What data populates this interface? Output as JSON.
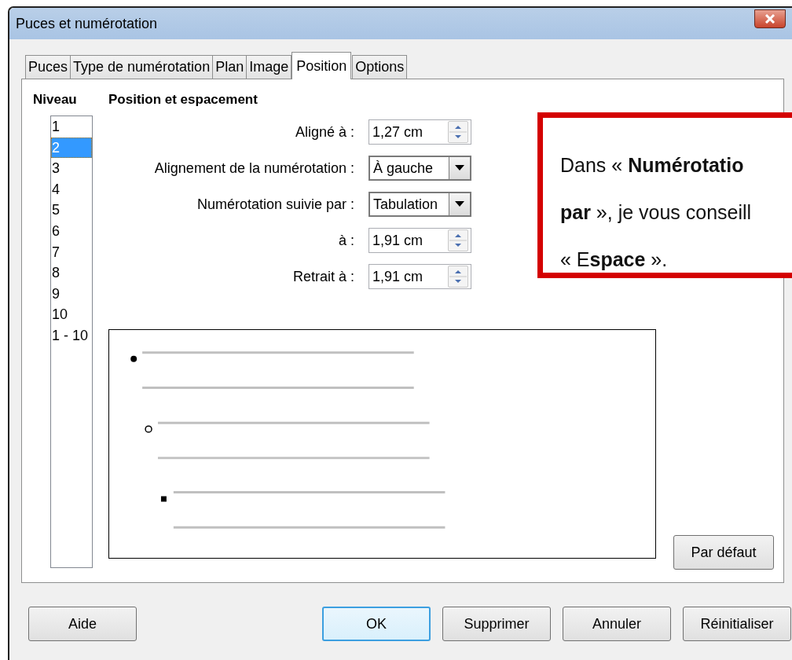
{
  "window": {
    "title": "Puces et numérotation"
  },
  "tabs": [
    {
      "label": "Puces",
      "selected": false
    },
    {
      "label": "Type de numérotation",
      "selected": false
    },
    {
      "label": "Plan",
      "selected": false
    },
    {
      "label": "Image",
      "selected": false
    },
    {
      "label": "Position",
      "selected": true
    },
    {
      "label": "Options",
      "selected": false
    }
  ],
  "level_list": {
    "label": "Niveau",
    "items": [
      {
        "label": "1",
        "selected": false
      },
      {
        "label": "2",
        "selected": true
      },
      {
        "label": "3",
        "selected": false
      },
      {
        "label": "4",
        "selected": false
      },
      {
        "label": "5",
        "selected": false
      },
      {
        "label": "6",
        "selected": false
      },
      {
        "label": "7",
        "selected": false
      },
      {
        "label": "8",
        "selected": false
      },
      {
        "label": "9",
        "selected": false
      },
      {
        "label": "10",
        "selected": false
      },
      {
        "label": "1 - 10",
        "selected": false
      }
    ]
  },
  "section_title": "Position et espacement",
  "fields": [
    {
      "label": "Aligné à :",
      "value": "1,27 cm",
      "kind": "spin"
    },
    {
      "label": "Alignement de la numérotation :",
      "value": "À gauche",
      "kind": "dropdown"
    },
    {
      "label": "Numérotation suivie par :",
      "value": "Tabulation",
      "kind": "dropdown"
    },
    {
      "label": "à :",
      "value": "1,91 cm",
      "kind": "spin"
    },
    {
      "label": "Retrait à :",
      "value": "1,91 cm",
      "kind": "spin"
    }
  ],
  "default_button": "Par défaut",
  "buttons": [
    {
      "label": "Aide",
      "default": false
    },
    {
      "label": "OK",
      "default": true
    },
    {
      "label": "Supprimer",
      "default": false
    },
    {
      "label": "Annuler",
      "default": false
    },
    {
      "label": "Réinitialiser",
      "default": false
    }
  ],
  "callout": {
    "lines": [
      "Dans « **Numérotatio**",
      "**par** », je vous conseill",
      "« E**space** »."
    ]
  }
}
